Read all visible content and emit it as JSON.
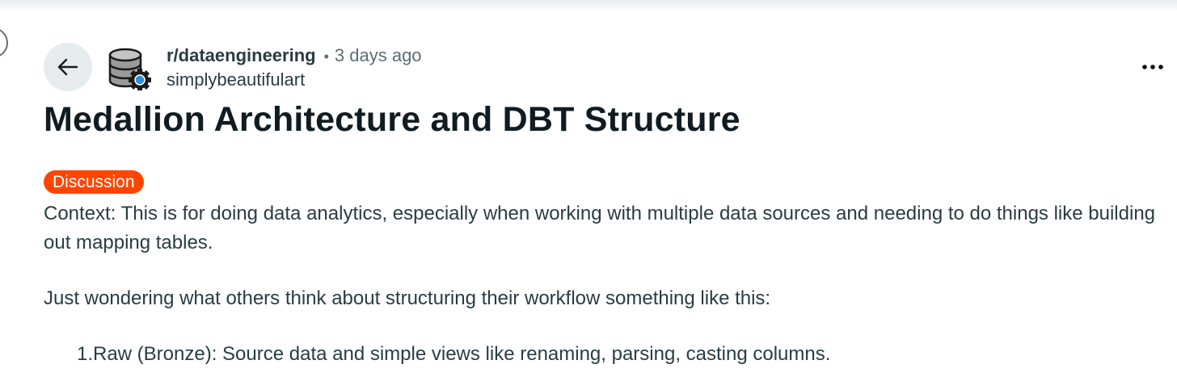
{
  "post": {
    "subreddit": "r/dataengineering",
    "separator": "•",
    "time_ago": "3 days ago",
    "author": "simplybeautifulart",
    "title": "Medallion Architecture and DBT Structure",
    "flair": "Discussion",
    "flair_color": "#ff4500",
    "paragraphs": [
      "Context: This is for doing data analytics, especially when working with multiple data sources and needing to do things like building out mapping tables.",
      "Just wondering what others think about structuring their workflow something like this:"
    ],
    "list_items": [
      {
        "number": "1.",
        "text": "Raw (Bronze): Source data and simple views like renaming, parsing, casting columns."
      }
    ]
  },
  "icons": {
    "back": "arrow-left-icon",
    "avatar": "database-gear-icon",
    "more": "more-horizontal-icon"
  }
}
